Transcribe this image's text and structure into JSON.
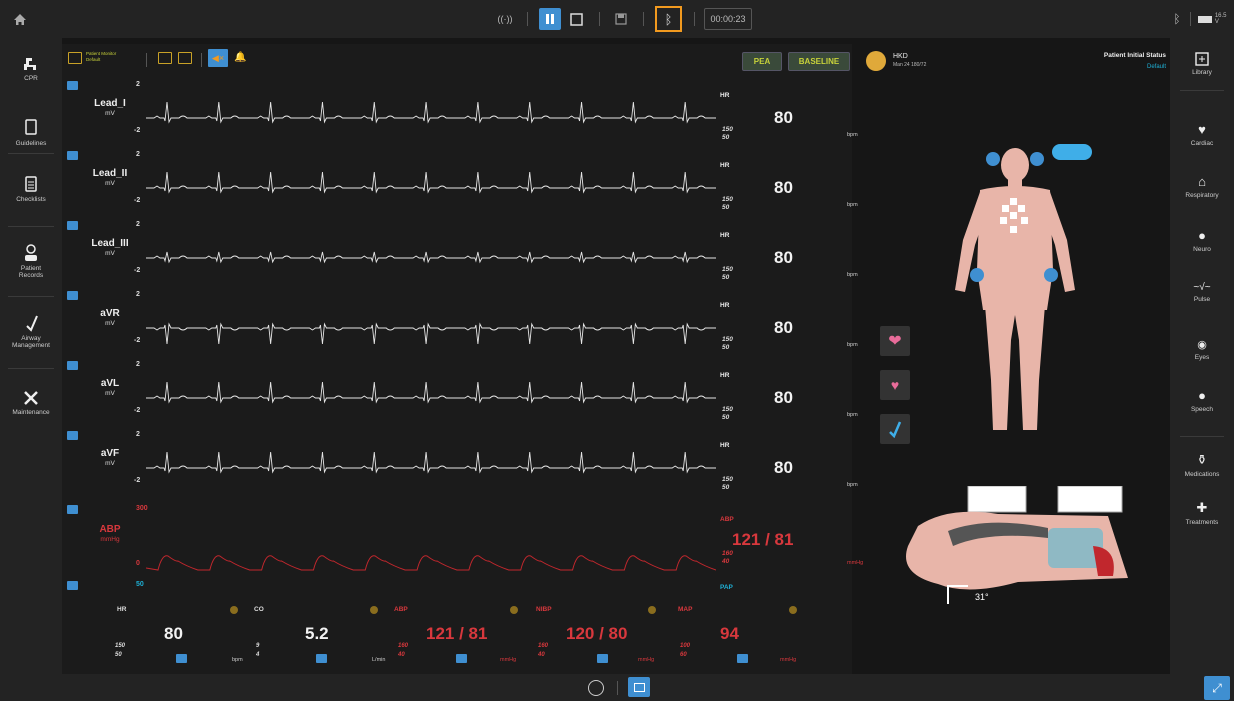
{
  "topbar": {
    "timer": "00:00:23",
    "battery": "16.5 V"
  },
  "leftnav": {
    "items": [
      {
        "label": "CPR",
        "icon": "cpr-icon"
      },
      {
        "label": "Guidelines",
        "icon": "guidelines-icon"
      },
      {
        "label": "Checklists",
        "icon": "checklist-icon"
      },
      {
        "label": "Patient Records",
        "icon": "patient-records-icon"
      },
      {
        "label": "Airway Management",
        "icon": "airway-icon"
      },
      {
        "label": "Maintenance",
        "icon": "maintenance-icon"
      }
    ]
  },
  "rightnav": {
    "items": [
      {
        "label": "Library",
        "icon": "library-icon"
      },
      {
        "label": "Cardiac",
        "icon": "cardiac-icon"
      },
      {
        "label": "Respiratory",
        "icon": "respiratory-icon"
      },
      {
        "label": "Neuro",
        "icon": "neuro-icon"
      },
      {
        "label": "Pulse",
        "icon": "pulse-icon"
      },
      {
        "label": "Eyes",
        "icon": "eyes-icon"
      },
      {
        "label": "Speech",
        "icon": "speech-icon"
      },
      {
        "label": "Medications",
        "icon": "medications-icon"
      },
      {
        "label": "Treatments",
        "icon": "treatments-icon"
      }
    ]
  },
  "monitor": {
    "layout_name": "Patient Monitor",
    "layout_sub": "Default"
  },
  "leads": [
    {
      "name": "Lead_I",
      "unit": "mV",
      "hi": "2",
      "lo": "-2",
      "param": "HR",
      "alarm_hi": "150",
      "alarm_lo": "50",
      "value": "80",
      "value_unit": "bpm"
    },
    {
      "name": "Lead_II",
      "unit": "mV",
      "hi": "2",
      "lo": "-2",
      "param": "HR",
      "alarm_hi": "150",
      "alarm_lo": "50",
      "value": "80",
      "value_unit": "bpm"
    },
    {
      "name": "Lead_III",
      "unit": "mV",
      "hi": "2",
      "lo": "-2",
      "param": "HR",
      "alarm_hi": "150",
      "alarm_lo": "50",
      "value": "80",
      "value_unit": "bpm"
    },
    {
      "name": "aVR",
      "unit": "mV",
      "hi": "2",
      "lo": "-2",
      "param": "HR",
      "alarm_hi": "150",
      "alarm_lo": "50",
      "value": "80",
      "value_unit": "bpm"
    },
    {
      "name": "aVL",
      "unit": "mV",
      "hi": "2",
      "lo": "-2",
      "param": "HR",
      "alarm_hi": "150",
      "alarm_lo": "50",
      "value": "80",
      "value_unit": "bpm"
    },
    {
      "name": "aVF",
      "unit": "mV",
      "hi": "2",
      "lo": "-2",
      "param": "HR",
      "alarm_hi": "150",
      "alarm_lo": "50",
      "value": "80",
      "value_unit": "bpm"
    }
  ],
  "abp": {
    "name": "ABP",
    "unit": "mmHg",
    "hi": "300",
    "lo": "0",
    "param": "ABP",
    "alarm_hi": "160",
    "alarm_lo": "40",
    "value": "121 / 81",
    "value_unit": "mmHg"
  },
  "pap": {
    "hi": "50",
    "param": "PAP"
  },
  "bottom": {
    "hr": {
      "label": "HR",
      "value": "80",
      "hi": "150",
      "lo": "50",
      "unit": "bpm"
    },
    "co": {
      "label": "CO",
      "value": "5.2",
      "hi": "9",
      "lo": "4",
      "unit": "L/min"
    },
    "abp": {
      "label": "ABP",
      "value": "121 / 81",
      "hi": "160",
      "lo": "40",
      "unit": "mmHg"
    },
    "nibp": {
      "label": "NIBP",
      "value": "120 / 80",
      "hi": "160",
      "lo": "40",
      "unit": "mmHg"
    },
    "map": {
      "label": "MAP",
      "value": "94",
      "hi": "100",
      "lo": "60",
      "unit": "mmHg"
    }
  },
  "status": {
    "rhythm": "PEA",
    "baseline": "BASELINE",
    "patient_name": "HKD",
    "patient_info": "Man 24 180/72",
    "initial_status_title": "Patient Initial Status",
    "initial_status_value": "Default"
  },
  "airway": {
    "angle": "31°"
  },
  "colors": {
    "accent": "#3f8fd1",
    "alarm": "#d8383d",
    "highlight": "#f29a1f",
    "label_yellow": "#c8d23a"
  }
}
